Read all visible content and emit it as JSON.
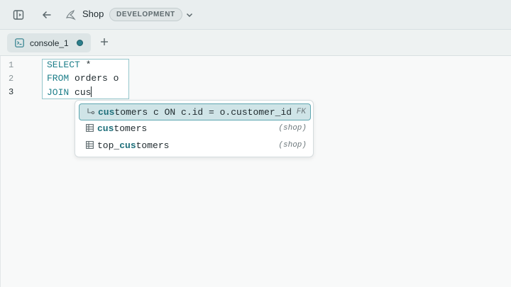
{
  "header": {
    "title": "Shop",
    "env_badge": "DEVELOPMENT",
    "icons": [
      "sidebar-toggle-icon",
      "back-arrow-icon",
      "database-icon",
      "chevron-down-icon"
    ]
  },
  "tabs": [
    {
      "label": "console_1",
      "icon": "console-icon",
      "unsaved_indicator": true
    }
  ],
  "add_tab_icon": "plus-icon",
  "editor": {
    "line_numbers": [
      "1",
      "2",
      "3"
    ],
    "active_line": 3,
    "lines": [
      {
        "keyword": "SELECT",
        "rest": " *"
      },
      {
        "keyword": "FROM",
        "rest": " orders o"
      },
      {
        "keyword": "JOIN",
        "rest": " cus"
      }
    ]
  },
  "autocomplete": {
    "typed_prefix": "cus",
    "selected_index": 0,
    "items": [
      {
        "icon": "foreign-key-icon",
        "match": "cus",
        "before": "",
        "after": "tomers c ON c.id = o.customer_id",
        "meta": "FK"
      },
      {
        "icon": "table-icon",
        "match": "cus",
        "before": "",
        "after": "tomers",
        "meta": "(shop)"
      },
      {
        "icon": "table-icon",
        "match": "cus",
        "before": "top_",
        "after": "tomers",
        "meta": "(shop)"
      }
    ]
  },
  "colors": {
    "accent": "#1e7f8a",
    "selection_bg": "#cfe4e7",
    "selection_border": "#5ea6b0",
    "topbar_bg": "#e9eeef"
  }
}
